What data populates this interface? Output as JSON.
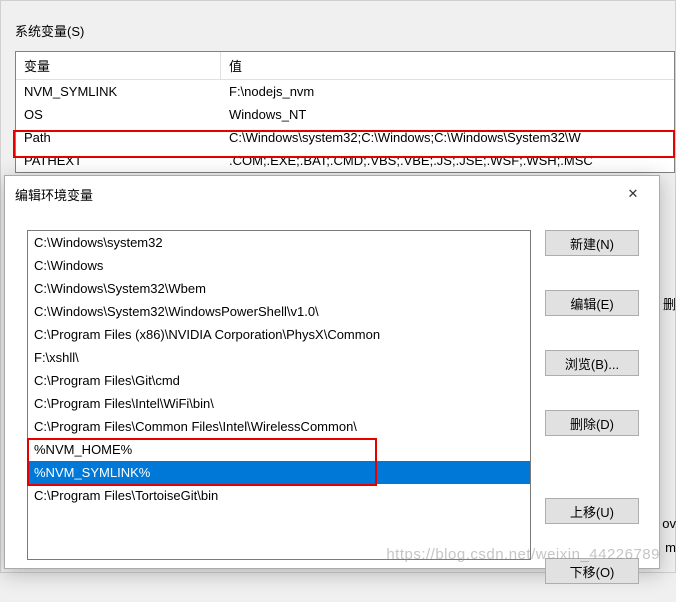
{
  "section_label": "系统变量(S)",
  "table": {
    "headers": {
      "variable": "变量",
      "value": "值"
    },
    "rows": [
      {
        "variable": "NVM_SYMLINK",
        "value": "F:\\nodejs_nvm"
      },
      {
        "variable": "OS",
        "value": "Windows_NT"
      },
      {
        "variable": "Path",
        "value": "C:\\Windows\\system32;C:\\Windows;C:\\Windows\\System32\\W"
      },
      {
        "variable": "PATHEXT",
        "value": ".COM;.EXE;.BAT;.CMD;.VBS;.VBE;.JS;.JSE;.WSF;.WSH;.MSC"
      }
    ],
    "highlighted_row_index": 2
  },
  "dialog": {
    "title": "编辑环境变量",
    "close_glyph": "✕",
    "list_items": [
      "C:\\Windows\\system32",
      "C:\\Windows",
      "C:\\Windows\\System32\\Wbem",
      "C:\\Windows\\System32\\WindowsPowerShell\\v1.0\\",
      "C:\\Program Files (x86)\\NVIDIA Corporation\\PhysX\\Common",
      "F:\\xshll\\",
      "C:\\Program Files\\Git\\cmd",
      "C:\\Program Files\\Intel\\WiFi\\bin\\",
      "C:\\Program Files\\Common Files\\Intel\\WirelessCommon\\",
      "%NVM_HOME%",
      "%NVM_SYMLINK%",
      "C:\\Program Files\\TortoiseGit\\bin"
    ],
    "selected_index": 10,
    "red_box_start": 9,
    "red_box_end": 10,
    "buttons": {
      "new": "新建(N)",
      "edit": "编辑(E)",
      "browse": "浏览(B)...",
      "delete": "删除(D)",
      "move_up": "上移(U)",
      "move_down": "下移(O)"
    }
  },
  "side_fragments": {
    "del": "删",
    "ov": "ov",
    "m": "m"
  },
  "watermark": "https://blog.csdn.net/weixin_44226789"
}
